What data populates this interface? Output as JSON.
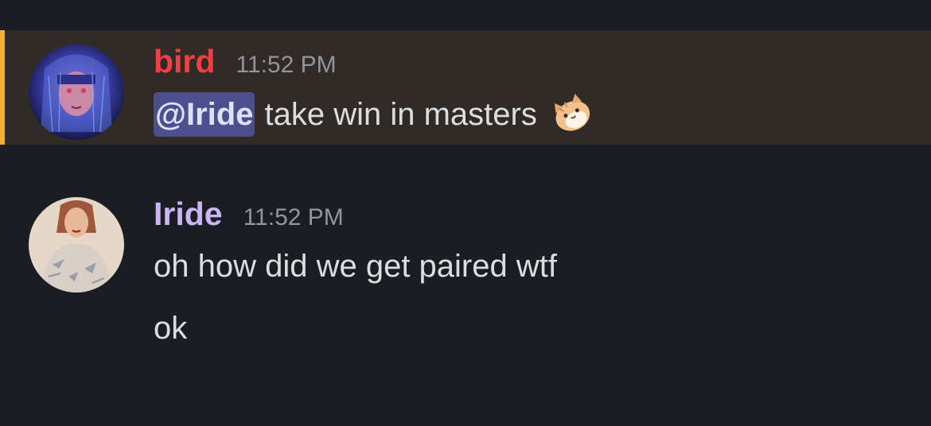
{
  "messages": [
    {
      "username": "bird",
      "timestamp": "11:52 PM",
      "mention": "@Iride",
      "text": "take win in masters",
      "emoji": "cat-emoji",
      "highlighted": true,
      "username_color": "#f23f43"
    },
    {
      "username": "Iride",
      "timestamp": "11:52 PM",
      "lines": [
        "oh how did we get paired wtf",
        "ok"
      ],
      "username_color": "#c9b6f7"
    }
  ],
  "colors": {
    "background": "#1c1d22",
    "mention_highlight_bg": "#302b26",
    "mention_bar": "#f0b132",
    "mention_pill": "#4c4f8e"
  }
}
